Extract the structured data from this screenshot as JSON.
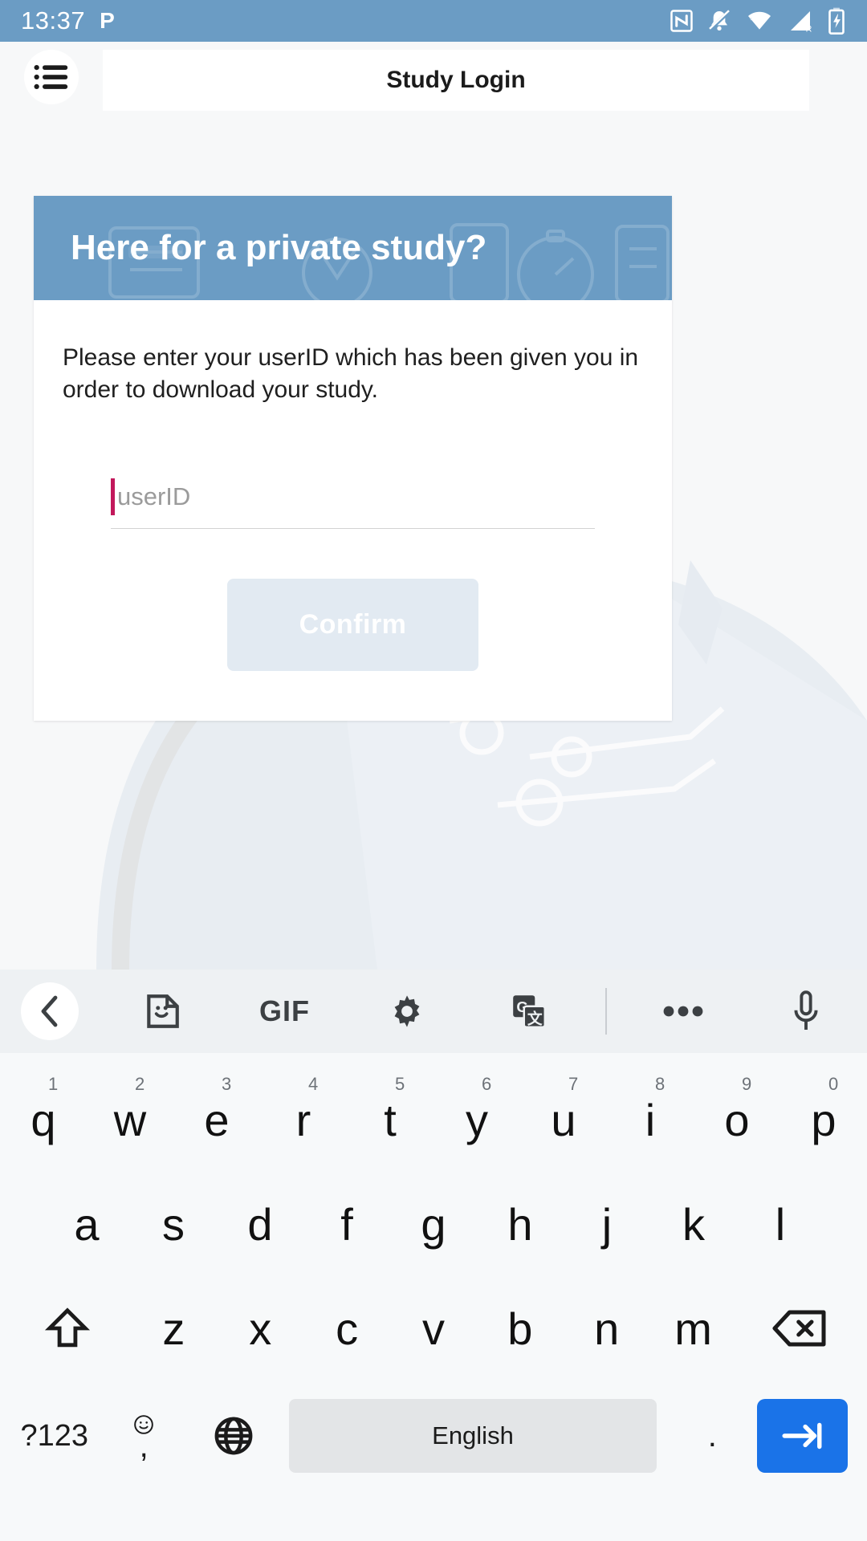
{
  "status_bar": {
    "time": "13:37",
    "app_indicator": "P",
    "icons": [
      "nfc-icon",
      "notifications-muted-icon",
      "wifi-icon",
      "cellular-signal-roaming-icon",
      "battery-charging-icon"
    ],
    "background_color": "#6b9cc4"
  },
  "app_bar": {
    "menu_icon": "list-menu-icon",
    "title": "Study Login"
  },
  "card": {
    "banner_title": "Here for a private study?",
    "banner_color": "#6b9cc4",
    "body_text": "Please enter your userID which has been given you in order to download your study.",
    "input": {
      "placeholder": "userID",
      "value": "",
      "caret_color": "#c2185b"
    },
    "confirm_button": {
      "label": "Confirm",
      "enabled": false,
      "background_color": "#e2eaf2",
      "text_color": "#ffffff"
    }
  },
  "keyboard": {
    "toolbar": {
      "back_icon": "chevron-left-icon",
      "items": [
        {
          "name": "sticker-icon",
          "label": ""
        },
        {
          "name": "gif-icon",
          "label": "GIF"
        },
        {
          "name": "settings-gear-icon",
          "label": ""
        },
        {
          "name": "google-translate-icon",
          "label": "G"
        },
        {
          "name": "more-options-icon",
          "label": ""
        },
        {
          "name": "microphone-icon",
          "label": ""
        }
      ]
    },
    "row1": [
      {
        "char": "q",
        "num": "1"
      },
      {
        "char": "w",
        "num": "2"
      },
      {
        "char": "e",
        "num": "3"
      },
      {
        "char": "r",
        "num": "4"
      },
      {
        "char": "t",
        "num": "5"
      },
      {
        "char": "y",
        "num": "6"
      },
      {
        "char": "u",
        "num": "7"
      },
      {
        "char": "i",
        "num": "8"
      },
      {
        "char": "o",
        "num": "9"
      },
      {
        "char": "p",
        "num": "0"
      }
    ],
    "row2": [
      {
        "char": "a"
      },
      {
        "char": "s"
      },
      {
        "char": "d"
      },
      {
        "char": "f"
      },
      {
        "char": "g"
      },
      {
        "char": "h"
      },
      {
        "char": "j"
      },
      {
        "char": "k"
      },
      {
        "char": "l"
      }
    ],
    "row3": [
      {
        "char": "z"
      },
      {
        "char": "x"
      },
      {
        "char": "c"
      },
      {
        "char": "v"
      },
      {
        "char": "b"
      },
      {
        "char": "n"
      },
      {
        "char": "m"
      }
    ],
    "shift_key": "shift-icon",
    "backspace_key": "backspace-icon",
    "row4": {
      "symbols_label": "?123",
      "comma_label": ",",
      "comma_emoji": "emoji-icon",
      "globe_label": "language-globe-icon",
      "space_label": "English",
      "period_label": ".",
      "enter_icon": "enter-arrow-icon",
      "enter_color": "#1a73e8"
    }
  }
}
